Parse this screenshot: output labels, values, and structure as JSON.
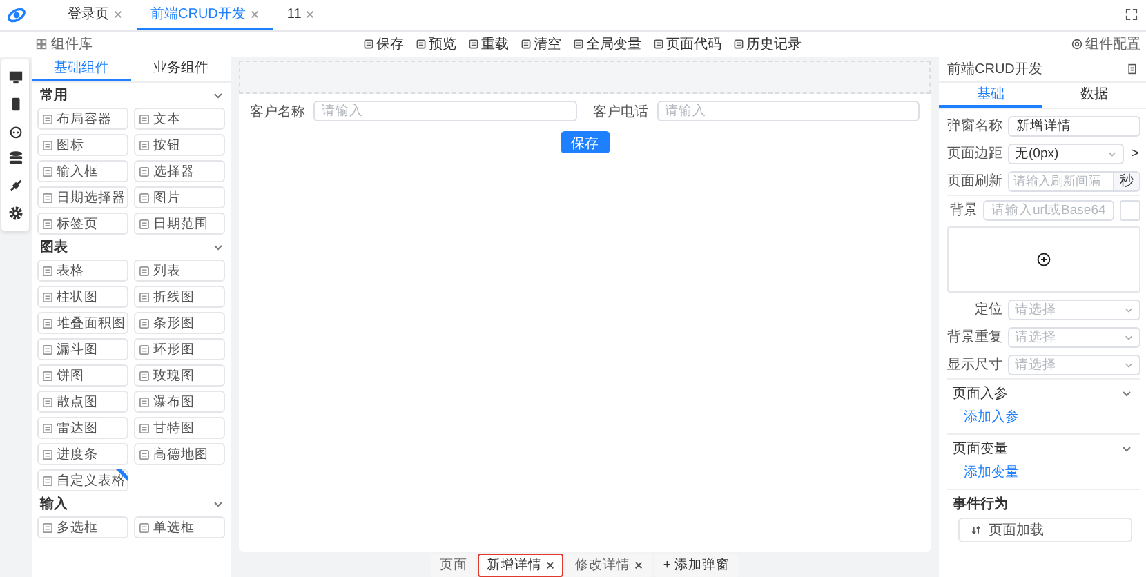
{
  "app_tabs": [
    {
      "label": "登录页",
      "selected": false
    },
    {
      "label": "前端CRUD开发",
      "selected": true
    },
    {
      "label": "11",
      "selected": false
    }
  ],
  "toolbar": {
    "library_label": "组件库",
    "actions": [
      "保存",
      "预览",
      "重载",
      "清空",
      "全局变量",
      "页面代码",
      "历史记录"
    ],
    "config_label": "组件配置"
  },
  "component_panel": {
    "tabs": [
      {
        "label": "基础组件",
        "selected": true
      },
      {
        "label": "业务组件",
        "selected": false
      }
    ],
    "groups": [
      {
        "title": "常用",
        "expanded": true,
        "items": [
          {
            "label": "布局容器",
            "marked": false
          },
          {
            "label": "文本",
            "marked": false
          },
          {
            "label": "图标",
            "marked": false
          },
          {
            "label": "按钮",
            "marked": false
          },
          {
            "label": "输入框",
            "marked": false
          },
          {
            "label": "选择器",
            "marked": false
          },
          {
            "label": "日期选择器",
            "marked": false
          },
          {
            "label": "图片",
            "marked": false
          },
          {
            "label": "标签页",
            "marked": false
          },
          {
            "label": "日期范围",
            "marked": false
          }
        ]
      },
      {
        "title": "图表",
        "expanded": true,
        "items": [
          {
            "label": "表格",
            "marked": false
          },
          {
            "label": "列表",
            "marked": false
          },
          {
            "label": "柱状图",
            "marked": false
          },
          {
            "label": "折线图",
            "marked": false
          },
          {
            "label": "堆叠面积图",
            "marked": false
          },
          {
            "label": "条形图",
            "marked": false
          },
          {
            "label": "漏斗图",
            "marked": false
          },
          {
            "label": "环形图",
            "marked": false
          },
          {
            "label": "饼图",
            "marked": false
          },
          {
            "label": "玫瑰图",
            "marked": false
          },
          {
            "label": "散点图",
            "marked": false
          },
          {
            "label": "瀑布图",
            "marked": false
          },
          {
            "label": "雷达图",
            "marked": false
          },
          {
            "label": "甘特图",
            "marked": false
          },
          {
            "label": "进度条",
            "marked": false
          },
          {
            "label": "高德地图",
            "marked": false
          },
          {
            "label": "自定义表格",
            "marked": true
          }
        ]
      },
      {
        "title": "输入",
        "expanded": true,
        "items": [
          {
            "label": "多选框",
            "marked": false
          },
          {
            "label": "单选框",
            "marked": false
          }
        ]
      }
    ]
  },
  "canvas": {
    "fields": [
      {
        "label": "客户名称",
        "placeholder": "请输入"
      },
      {
        "label": "客户电话",
        "placeholder": "请输入"
      }
    ],
    "button": "保存"
  },
  "page_tabs": [
    {
      "label": "页面",
      "selected": false,
      "closable": false
    },
    {
      "label": "新增详情",
      "selected": true,
      "closable": true
    },
    {
      "label": "修改详情",
      "selected": false,
      "closable": true
    }
  ],
  "add_page_tab": "+ 添加弹窗",
  "config_panel": {
    "title": "前端CRUD开发",
    "tabs": [
      {
        "label": "基础",
        "selected": true
      },
      {
        "label": "数据",
        "selected": false
      }
    ],
    "dialog_name": {
      "label": "弹窗名称",
      "value": "新增详情"
    },
    "padding": {
      "label": "页面边距",
      "value": "无(0px)",
      "arrow": ">"
    },
    "refresh": {
      "label": "页面刷新",
      "placeholder": "请输入刷新间隔",
      "suffix": "秒"
    },
    "background": {
      "label": "背景",
      "placeholder": "请输入url或Base64"
    },
    "selects": [
      {
        "label": "定位",
        "placeholder": "请选择"
      },
      {
        "label": "背景重复",
        "placeholder": "请选择"
      },
      {
        "label": "显示尺寸",
        "placeholder": "请选择"
      }
    ],
    "sections": [
      {
        "title": "页面入参",
        "expanded": true,
        "link": "添加入参"
      },
      {
        "title": "页面变量",
        "expanded": true,
        "link": "添加变量"
      }
    ],
    "events": {
      "title": "事件行为",
      "items": [
        "页面加载"
      ]
    }
  }
}
